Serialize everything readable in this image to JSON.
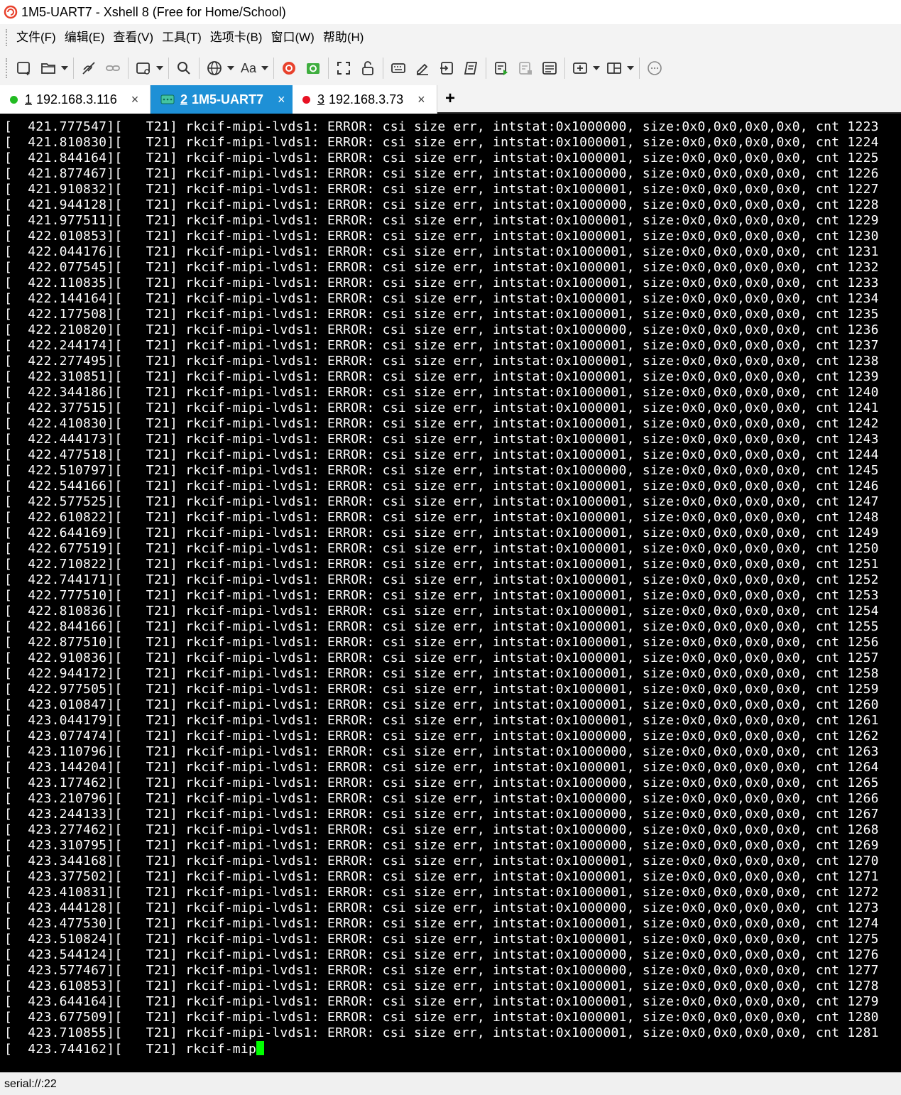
{
  "window": {
    "title": "1M5-UART7 - Xshell 8 (Free for Home/School)",
    "app_icon": "xshell-snail-icon",
    "accent_color": "#1e90d6"
  },
  "menu": {
    "items": [
      "文件(F)",
      "编辑(E)",
      "查看(V)",
      "工具(T)",
      "选项卡(B)",
      "窗口(W)",
      "帮助(H)"
    ]
  },
  "toolbar": {
    "icons": [
      "new-session-icon",
      "open-folder-icon",
      "disconnect-icon",
      "reconnect-icon",
      "new-tab-icon",
      "search-icon",
      "globe-icon",
      "font-icon",
      "xshell-icon",
      "xftp-icon",
      "fullscreen-icon",
      "lock-icon",
      "keyboard-icon",
      "compose-icon",
      "transfer-icon",
      "script-icon",
      "log-start-icon",
      "log-stop-icon",
      "notes-icon",
      "add-tab-icon",
      "layout-icon",
      "chat-icon"
    ],
    "font_label": "Aa"
  },
  "tabs": [
    {
      "num": "1",
      "label": "192.168.3.116",
      "status_color": "#22bb22",
      "active": false
    },
    {
      "num": "2",
      "label": "1M5-UART7",
      "status_color": "#44c4a1",
      "active": true
    },
    {
      "num": "3",
      "label": "192.168.3.73",
      "status_color": "#e81123",
      "active": false
    }
  ],
  "tab_close": "×",
  "tab_add": "+",
  "terminal": {
    "background": "#000000",
    "foreground": "#ffffff",
    "cursor_color": "#00ff00",
    "message": "rkcif-mipi-lvds1: ERROR: csi size err, intstat:",
    "size_text": "size:0x0,0x0,0x0,0x0, cnt",
    "thread": "T21",
    "lines": [
      [
        "421.777547",
        "0x1000000",
        "1223"
      ],
      [
        "421.810830",
        "0x1000001",
        "1224"
      ],
      [
        "421.844164",
        "0x1000001",
        "1225"
      ],
      [
        "421.877467",
        "0x1000000",
        "1226"
      ],
      [
        "421.910832",
        "0x1000001",
        "1227"
      ],
      [
        "421.944128",
        "0x1000000",
        "1228"
      ],
      [
        "421.977511",
        "0x1000001",
        "1229"
      ],
      [
        "422.010853",
        "0x1000001",
        "1230"
      ],
      [
        "422.044176",
        "0x1000001",
        "1231"
      ],
      [
        "422.077545",
        "0x1000001",
        "1232"
      ],
      [
        "422.110835",
        "0x1000001",
        "1233"
      ],
      [
        "422.144164",
        "0x1000001",
        "1234"
      ],
      [
        "422.177508",
        "0x1000001",
        "1235"
      ],
      [
        "422.210820",
        "0x1000000",
        "1236"
      ],
      [
        "422.244174",
        "0x1000001",
        "1237"
      ],
      [
        "422.277495",
        "0x1000001",
        "1238"
      ],
      [
        "422.310851",
        "0x1000001",
        "1239"
      ],
      [
        "422.344186",
        "0x1000001",
        "1240"
      ],
      [
        "422.377515",
        "0x1000001",
        "1241"
      ],
      [
        "422.410830",
        "0x1000001",
        "1242"
      ],
      [
        "422.444173",
        "0x1000001",
        "1243"
      ],
      [
        "422.477518",
        "0x1000001",
        "1244"
      ],
      [
        "422.510797",
        "0x1000000",
        "1245"
      ],
      [
        "422.544166",
        "0x1000001",
        "1246"
      ],
      [
        "422.577525",
        "0x1000001",
        "1247"
      ],
      [
        "422.610822",
        "0x1000001",
        "1248"
      ],
      [
        "422.644169",
        "0x1000001",
        "1249"
      ],
      [
        "422.677519",
        "0x1000001",
        "1250"
      ],
      [
        "422.710822",
        "0x1000001",
        "1251"
      ],
      [
        "422.744171",
        "0x1000001",
        "1252"
      ],
      [
        "422.777510",
        "0x1000001",
        "1253"
      ],
      [
        "422.810836",
        "0x1000001",
        "1254"
      ],
      [
        "422.844166",
        "0x1000001",
        "1255"
      ],
      [
        "422.877510",
        "0x1000001",
        "1256"
      ],
      [
        "422.910836",
        "0x1000001",
        "1257"
      ],
      [
        "422.944172",
        "0x1000001",
        "1258"
      ],
      [
        "422.977505",
        "0x1000001",
        "1259"
      ],
      [
        "423.010847",
        "0x1000001",
        "1260"
      ],
      [
        "423.044179",
        "0x1000001",
        "1261"
      ],
      [
        "423.077474",
        "0x1000000",
        "1262"
      ],
      [
        "423.110796",
        "0x1000000",
        "1263"
      ],
      [
        "423.144204",
        "0x1000001",
        "1264"
      ],
      [
        "423.177462",
        "0x1000000",
        "1265"
      ],
      [
        "423.210796",
        "0x1000000",
        "1266"
      ],
      [
        "423.244133",
        "0x1000000",
        "1267"
      ],
      [
        "423.277462",
        "0x1000000",
        "1268"
      ],
      [
        "423.310795",
        "0x1000000",
        "1269"
      ],
      [
        "423.344168",
        "0x1000001",
        "1270"
      ],
      [
        "423.377502",
        "0x1000001",
        "1271"
      ],
      [
        "423.410831",
        "0x1000001",
        "1272"
      ],
      [
        "423.444128",
        "0x1000000",
        "1273"
      ],
      [
        "423.477530",
        "0x1000001",
        "1274"
      ],
      [
        "423.510824",
        "0x1000001",
        "1275"
      ],
      [
        "423.544124",
        "0x1000000",
        "1276"
      ],
      [
        "423.577467",
        "0x1000000",
        "1277"
      ],
      [
        "423.610853",
        "0x1000001",
        "1278"
      ],
      [
        "423.644164",
        "0x1000001",
        "1279"
      ],
      [
        "423.677509",
        "0x1000001",
        "1280"
      ],
      [
        "423.710855",
        "0x1000001",
        "1281"
      ]
    ],
    "partial_line": "[  423.744162][   T21] rkcif-mip"
  },
  "status": {
    "text": "serial://:22"
  }
}
